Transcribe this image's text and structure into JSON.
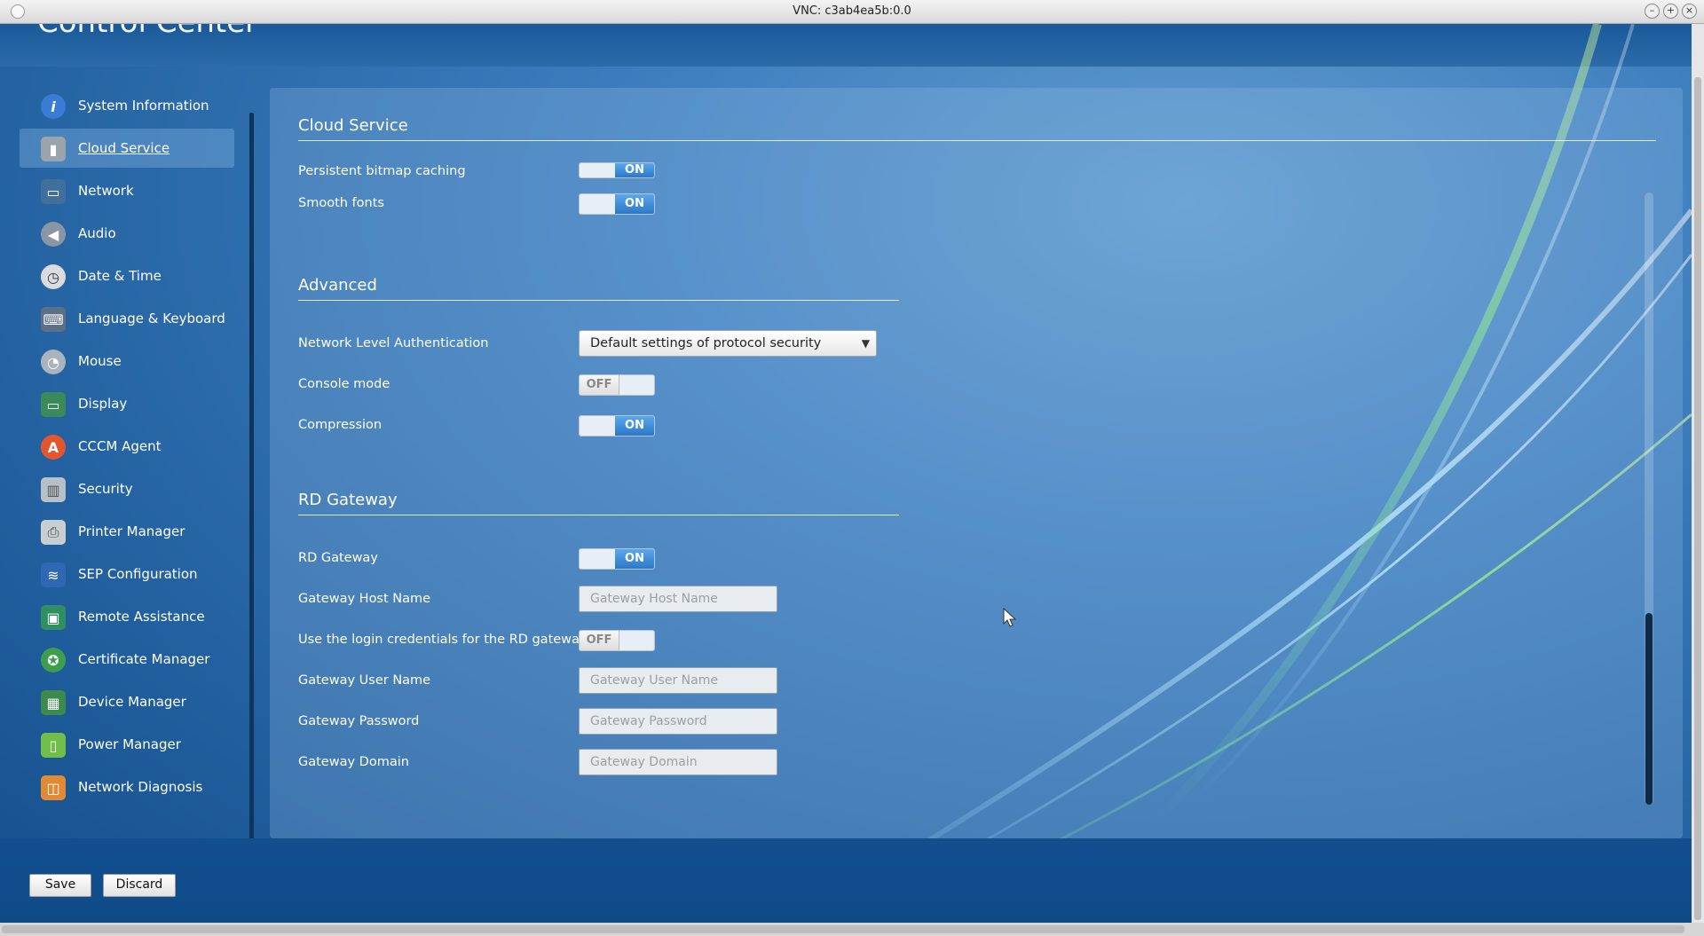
{
  "window": {
    "title": "VNC: c3ab4ea5b:0.0"
  },
  "app": {
    "heading": "Control Center"
  },
  "sidebar": {
    "items": [
      {
        "label": "System Information",
        "icon": "info-icon",
        "color": "#3a7bd5",
        "glyph": "i"
      },
      {
        "label": "Cloud Service",
        "icon": "cloud-service-icon",
        "color": "#9aa4ad",
        "glyph": "▮"
      },
      {
        "label": "Network",
        "icon": "network-icon",
        "color": "#3f6f9a",
        "glyph": "🖧"
      },
      {
        "label": "Audio",
        "icon": "speaker-icon",
        "color": "#8a96a3",
        "glyph": "◀"
      },
      {
        "label": "Date & Time",
        "icon": "clock-icon",
        "color": "#d9dde2",
        "glyph": "◷"
      },
      {
        "label": "Language & Keyboard",
        "icon": "keyboard-icon",
        "color": "#5b6f86",
        "glyph": "⌨"
      },
      {
        "label": "Mouse",
        "icon": "mouse-icon",
        "color": "#a9b4be",
        "glyph": "◔"
      },
      {
        "label": "Display",
        "icon": "display-icon",
        "color": "#3b8b5a",
        "glyph": "▭"
      },
      {
        "label": "CCCM Agent",
        "icon": "agent-icon",
        "color": "#e4572e",
        "glyph": "A"
      },
      {
        "label": "Security",
        "icon": "security-icon",
        "color": "#b7bfc7",
        "glyph": "▥"
      },
      {
        "label": "Printer Manager",
        "icon": "printer-icon",
        "color": "#c9ced3",
        "glyph": "⎙"
      },
      {
        "label": "SEP Configuration",
        "icon": "sep-icon",
        "color": "#2f67b2",
        "glyph": "≋"
      },
      {
        "label": "Remote Assistance",
        "icon": "remote-assistance-icon",
        "color": "#2f8f61",
        "glyph": "▣"
      },
      {
        "label": "Certificate Manager",
        "icon": "certificate-icon",
        "color": "#3e9e4e",
        "glyph": "✪"
      },
      {
        "label": "Device Manager",
        "icon": "device-icon",
        "color": "#3c8a4d",
        "glyph": "▦"
      },
      {
        "label": "Power Manager",
        "icon": "battery-icon",
        "color": "#6fbf4a",
        "glyph": "▯"
      },
      {
        "label": "Network Diagnosis",
        "icon": "network-diagnosis-icon",
        "color": "#e08a35",
        "glyph": "◫"
      }
    ],
    "active_index": 1
  },
  "content": {
    "cloud_service": {
      "title": "Cloud Service",
      "persistent_bitmap": {
        "label": "Persistent bitmap caching",
        "state": "ON"
      },
      "smooth_fonts": {
        "label": "Smooth fonts",
        "state": "ON"
      }
    },
    "advanced": {
      "title": "Advanced",
      "nla": {
        "label": "Network Level Authentication",
        "value": "Default settings of protocol security"
      },
      "console_mode": {
        "label": "Console mode",
        "state": "OFF"
      },
      "compression": {
        "label": "Compression",
        "state": "ON"
      }
    },
    "rd_gateway": {
      "title": "RD Gateway",
      "enabled": {
        "label": "RD Gateway",
        "state": "ON"
      },
      "host": {
        "label": "Gateway Host Name",
        "placeholder": "Gateway Host Name"
      },
      "use_login": {
        "label": "Use the login credentials for the RD gateway",
        "state": "OFF"
      },
      "user": {
        "label": "Gateway User Name",
        "placeholder": "Gateway User Name"
      },
      "password": {
        "label": "Gateway Password",
        "placeholder": "Gateway Password"
      },
      "domain": {
        "label": "Gateway Domain",
        "placeholder": "Gateway Domain"
      }
    }
  },
  "footer": {
    "save_label": "Save",
    "discard_label": "Discard"
  }
}
